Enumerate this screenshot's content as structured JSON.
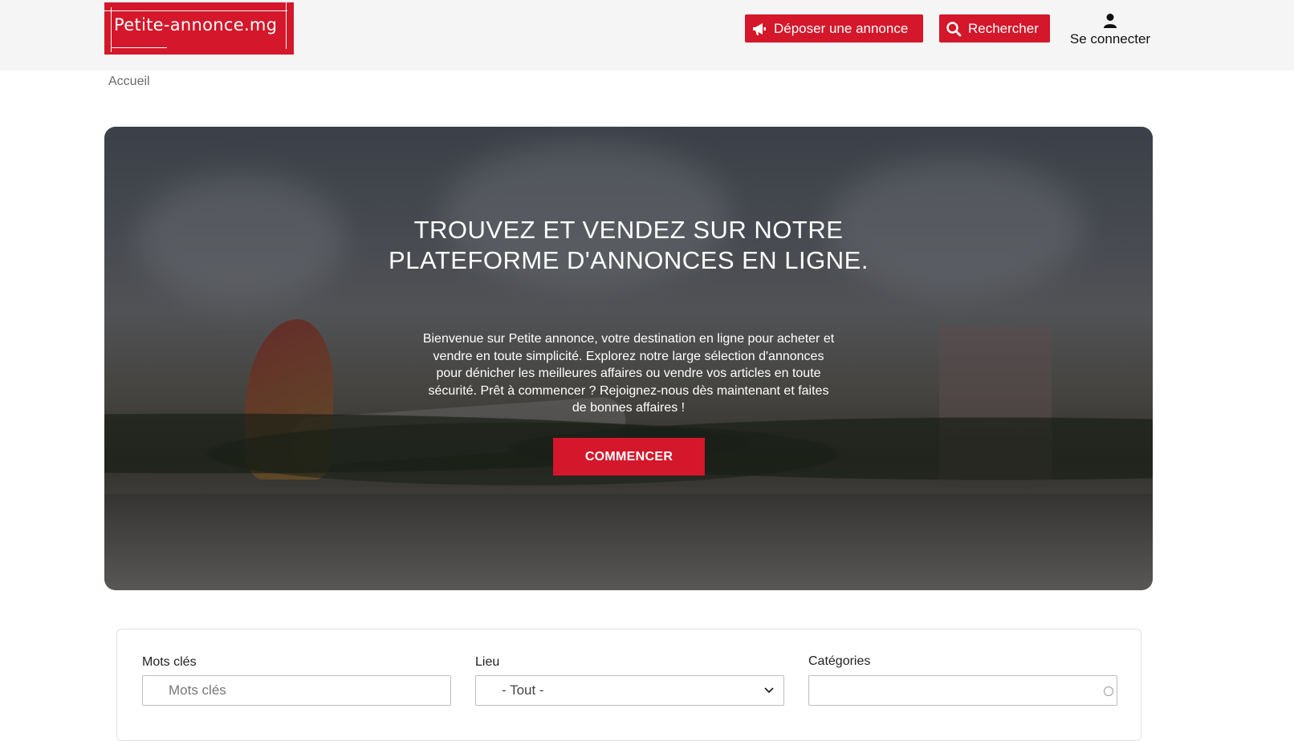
{
  "header": {
    "logo_text": "Petite-annonce.mg",
    "post_ad_label": "Déposer une annonce",
    "search_label": "Rechercher",
    "login_label": "Se connecter",
    "brand_color": "#d4172a"
  },
  "breadcrumb": {
    "home": "Accueil"
  },
  "hero": {
    "title": "TROUVEZ ET VENDEZ SUR NOTRE PLATEFORME D'ANNONCES EN LIGNE.",
    "text": "Bienvenue sur Petite annonce, votre destination en ligne pour acheter et vendre en toute simplicité. Explorez notre large sélection d'annonces pour dénicher les meilleures affaires ou vendre vos articles en toute sécurité. Prêt à commencer ? Rejoignez-nous dès maintenant et faites de bonnes affaires !",
    "cta_label": "COMMENCER"
  },
  "search_form": {
    "keywords_label": "Mots clés",
    "keywords_placeholder": "Mots clés",
    "location_label": "Lieu",
    "location_value": "- Tout -",
    "categories_label": "Catégories",
    "categories_value": ""
  },
  "icons": {
    "post_ad": "megaphone-icon",
    "search": "search-icon",
    "login": "user-icon",
    "dropdown": "chevron-down-icon"
  }
}
